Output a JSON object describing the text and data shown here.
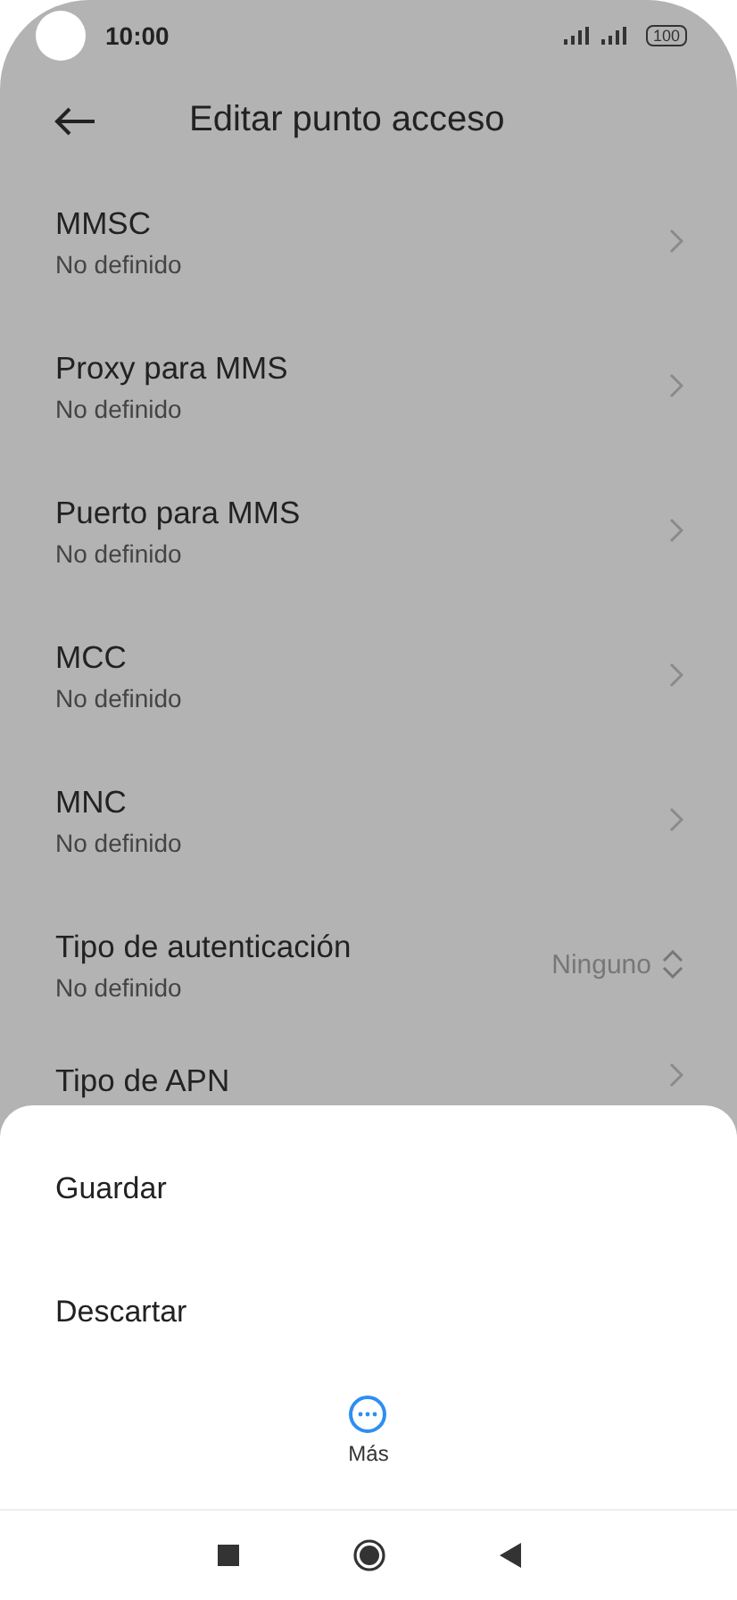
{
  "status_bar": {
    "time": "10:00",
    "battery": "100"
  },
  "header": {
    "title": "Editar punto acceso"
  },
  "settings": [
    {
      "kind": "link",
      "label": "MMSC",
      "value": "No definido"
    },
    {
      "kind": "link",
      "label": "Proxy para MMS",
      "value": "No definido"
    },
    {
      "kind": "link",
      "label": "Puerto para MMS",
      "value": "No definido"
    },
    {
      "kind": "link",
      "label": "MCC",
      "value": "No definido"
    },
    {
      "kind": "link",
      "label": "MNC",
      "value": "No definido"
    },
    {
      "kind": "select",
      "label": "Tipo de autenticación",
      "value": "No definido",
      "choice": "Ninguno"
    },
    {
      "kind": "link",
      "label": "Tipo de APN"
    }
  ],
  "sheet": {
    "actions": [
      "Guardar",
      "Descartar"
    ],
    "more": "Más"
  }
}
